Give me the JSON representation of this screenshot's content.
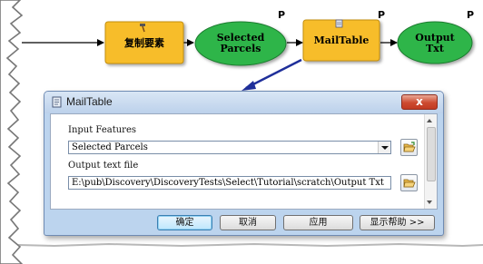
{
  "model": {
    "nodes": {
      "copy_features": {
        "label": "复制要素",
        "shape": "rectangle",
        "color": "#f7bd2b"
      },
      "selected_parcels": {
        "label_line1": "Selected",
        "label_line2": "Parcels",
        "shape": "ellipse",
        "color": "#2fb54a"
      },
      "mailtable": {
        "label": "MailTable",
        "shape": "rectangle",
        "color": "#f7bd2b",
        "param_marker": "P"
      },
      "output_txt": {
        "label_line1": "Output",
        "label_line2": "Txt",
        "shape": "ellipse",
        "color": "#2fb54a",
        "param_marker": "P"
      }
    },
    "selected_parcels_marker": "P"
  },
  "dialog": {
    "title": "MailTable",
    "close_glyph": "x",
    "fields": {
      "input_features": {
        "label": "Input Features",
        "value": "Selected Parcels"
      },
      "output_text_file": {
        "label": "Output text file",
        "value": "E:\\pub\\Discovery\\DiscoveryTests\\Select\\Tutorial\\scratch\\Output Txt"
      }
    },
    "buttons": {
      "ok": "确定",
      "cancel": "取消",
      "apply": "应用",
      "show_help": "显示帮助 >>"
    }
  },
  "colors": {
    "tool_fill": "#f7bd2b",
    "data_fill": "#2fb54a",
    "dialog_frame": "#bcd4ee",
    "arrow": "#1f2f9a"
  },
  "icons": [
    "hammer-icon",
    "script-icon",
    "folder-open-icon",
    "close-icon",
    "dropdown-arrow-icon"
  ]
}
